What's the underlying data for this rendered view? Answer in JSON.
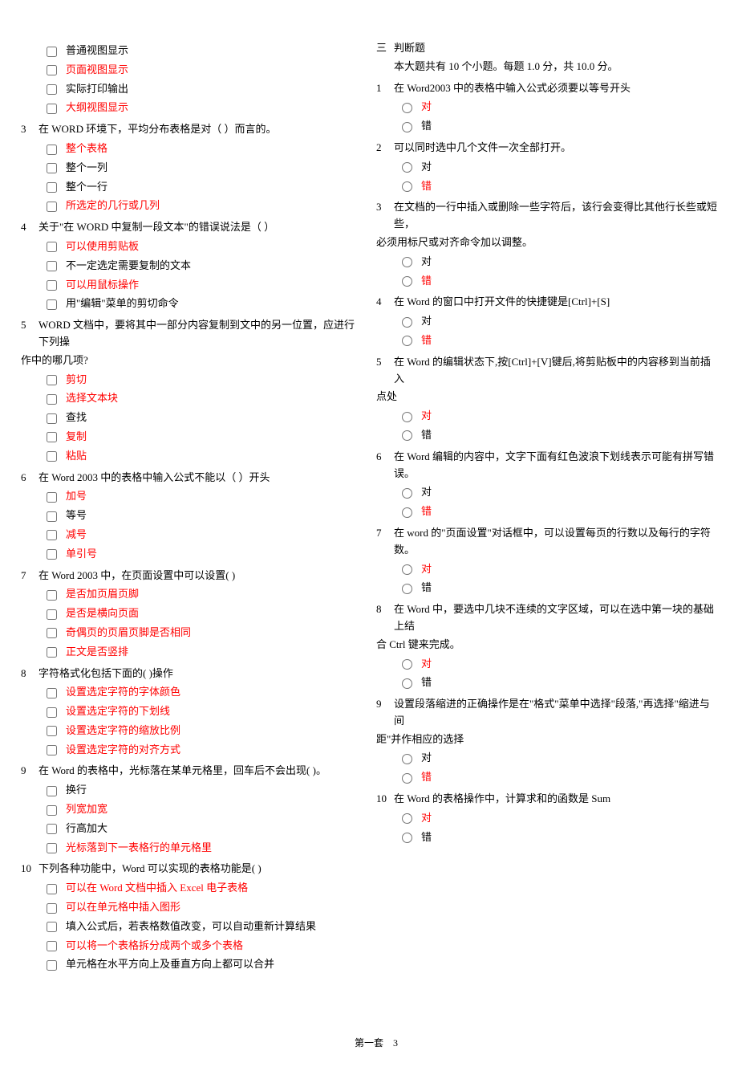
{
  "left": {
    "pre_opts": [
      {
        "text": "普通视图显示",
        "red": false
      },
      {
        "text": "页面视图显示",
        "red": true
      },
      {
        "text": "实际打印输出",
        "red": false
      },
      {
        "text": "大纲视图显示",
        "red": true
      }
    ],
    "questions": [
      {
        "num": "3",
        "text": "在 WORD 环境下，平均分布表格是对（ ）而言的。",
        "opts": [
          {
            "text": "整个表格",
            "red": true
          },
          {
            "text": "整个一列",
            "red": false
          },
          {
            "text": "整个一行",
            "red": false
          },
          {
            "text": "所选定的几行或几列",
            "red": true
          }
        ]
      },
      {
        "num": "4",
        "text": "关于\"在 WORD 中复制一段文本\"的错误说法是（ ）",
        "opts": [
          {
            "text": "可以使用剪贴板",
            "red": true
          },
          {
            "text": "不一定选定需要复制的文本",
            "red": false
          },
          {
            "text": "可以用鼠标操作",
            "red": true
          },
          {
            "text": "用\"编辑\"菜单的剪切命令",
            "red": false
          }
        ]
      },
      {
        "num": "5",
        "text": "WORD 文档中，要将其中一部分内容复制到文中的另一位置，应进行下列操",
        "cont": "作中的哪几项?",
        "opts": [
          {
            "text": "剪切",
            "red": true
          },
          {
            "text": "选择文本块",
            "red": true
          },
          {
            "text": "查找",
            "red": false
          },
          {
            "text": "复制",
            "red": true
          },
          {
            "text": "粘贴",
            "red": true
          }
        ]
      },
      {
        "num": "6",
        "text": "在 Word 2003 中的表格中输入公式不能以（ ）开头",
        "opts": [
          {
            "text": "加号",
            "red": true
          },
          {
            "text": "等号",
            "red": false
          },
          {
            "text": "减号",
            "red": true
          },
          {
            "text": "单引号",
            "red": true
          }
        ]
      },
      {
        "num": "7",
        "text": "在 Word 2003 中，在页面设置中可以设置( )",
        "opts": [
          {
            "text": "是否加页眉页脚",
            "red": true
          },
          {
            "text": "是否是横向页面",
            "red": true
          },
          {
            "text": "奇偶页的页眉页脚是否相同",
            "red": true
          },
          {
            "text": "正文是否竖排",
            "red": true
          }
        ]
      },
      {
        "num": "8",
        "text": "字符格式化包括下面的( )操作",
        "opts": [
          {
            "text": "设置选定字符的字体颜色",
            "red": true
          },
          {
            "text": "设置选定字符的下划线",
            "red": true
          },
          {
            "text": "设置选定字符的缩放比例",
            "red": true
          },
          {
            "text": "设置选定字符的对齐方式",
            "red": true
          }
        ]
      },
      {
        "num": "9",
        "text": "在 Word 的表格中，光标落在某单元格里，回车后不会出现( )。",
        "opts": [
          {
            "text": "换行",
            "red": false
          },
          {
            "text": "列宽加宽",
            "red": true
          },
          {
            "text": "行高加大",
            "red": false
          },
          {
            "text": "光标落到下一表格行的单元格里",
            "red": true
          }
        ]
      },
      {
        "num": "10",
        "text": "下列各种功能中，Word 可以实现的表格功能是( )",
        "opts": [
          {
            "text": "可以在 Word 文档中插入 Excel 电子表格",
            "red": true
          },
          {
            "text": "可以在单元格中插入图形",
            "red": true
          },
          {
            "text": "填入公式后，若表格数值改变，可以自动重新计算结果",
            "red": false
          }
        ]
      }
    ]
  },
  "right": {
    "carry_opts": [
      {
        "text": "可以将一个表格拆分成两个或多个表格",
        "red": true
      },
      {
        "text": "单元格在水平方向上及垂直方向上都可以合并",
        "red": false
      }
    ],
    "section": {
      "num": "三",
      "title": "判断题",
      "sub": "本大题共有 10 个小题。每题 1.0 分，共 10.0 分。"
    },
    "tf": [
      {
        "num": "1",
        "text": "在 Word2003 中的表格中输入公式必须要以等号开头",
        "opts": [
          {
            "text": "对",
            "red": true
          },
          {
            "text": "错",
            "red": false
          }
        ]
      },
      {
        "num": "2",
        "text": "可以同时选中几个文件一次全部打开。",
        "opts": [
          {
            "text": "对",
            "red": false
          },
          {
            "text": "错",
            "red": true
          }
        ]
      },
      {
        "num": "3",
        "text": "在文档的一行中插入或删除一些字符后，该行会变得比其他行长些或短些，",
        "cont": "必须用标尺或对齐命令加以调整。",
        "opts": [
          {
            "text": "对",
            "red": false
          },
          {
            "text": "错",
            "red": true
          }
        ]
      },
      {
        "num": "4",
        "text": "在 Word 的窗口中打开文件的快捷键是[Ctrl]+[S]",
        "opts": [
          {
            "text": "对",
            "red": false
          },
          {
            "text": "错",
            "red": true
          }
        ]
      },
      {
        "num": "5",
        "text": "在 Word 的编辑状态下,按[Ctrl]+[V]键后,将剪贴板中的内容移到当前插入",
        "cont": "点处",
        "opts": [
          {
            "text": "对",
            "red": true
          },
          {
            "text": "错",
            "red": false
          }
        ]
      },
      {
        "num": "6",
        "text": "在 Word 编辑的内容中，文字下面有红色波浪下划线表示可能有拼写错误。",
        "opts": [
          {
            "text": "对",
            "red": false
          },
          {
            "text": "错",
            "red": true
          }
        ]
      },
      {
        "num": "7",
        "text": "在 word 的\"页面设置\"对话框中，可以设置每页的行数以及每行的字符数。",
        "opts": [
          {
            "text": "对",
            "red": true
          },
          {
            "text": "错",
            "red": false
          }
        ]
      },
      {
        "num": "8",
        "text": "在 Word 中，要选中几块不连续的文字区域，可以在选中第一块的基础上结",
        "cont": "合 Ctrl 键来完成。",
        "opts": [
          {
            "text": "对",
            "red": true
          },
          {
            "text": "错",
            "red": false
          }
        ]
      },
      {
        "num": "9",
        "text": "设置段落缩进的正确操作是在\"格式\"菜单中选择\"段落,\"再选择\"缩进与间",
        "cont": "距\"并作相应的选择",
        "opts": [
          {
            "text": "对",
            "red": false
          },
          {
            "text": "错",
            "red": true
          }
        ]
      },
      {
        "num": "10",
        "text": "在 Word 的表格操作中，计算求和的函数是 Sum",
        "opts": [
          {
            "text": "对",
            "red": true
          },
          {
            "text": "错",
            "red": false
          }
        ]
      }
    ]
  },
  "footer": {
    "label": "第一套",
    "page": "3"
  }
}
